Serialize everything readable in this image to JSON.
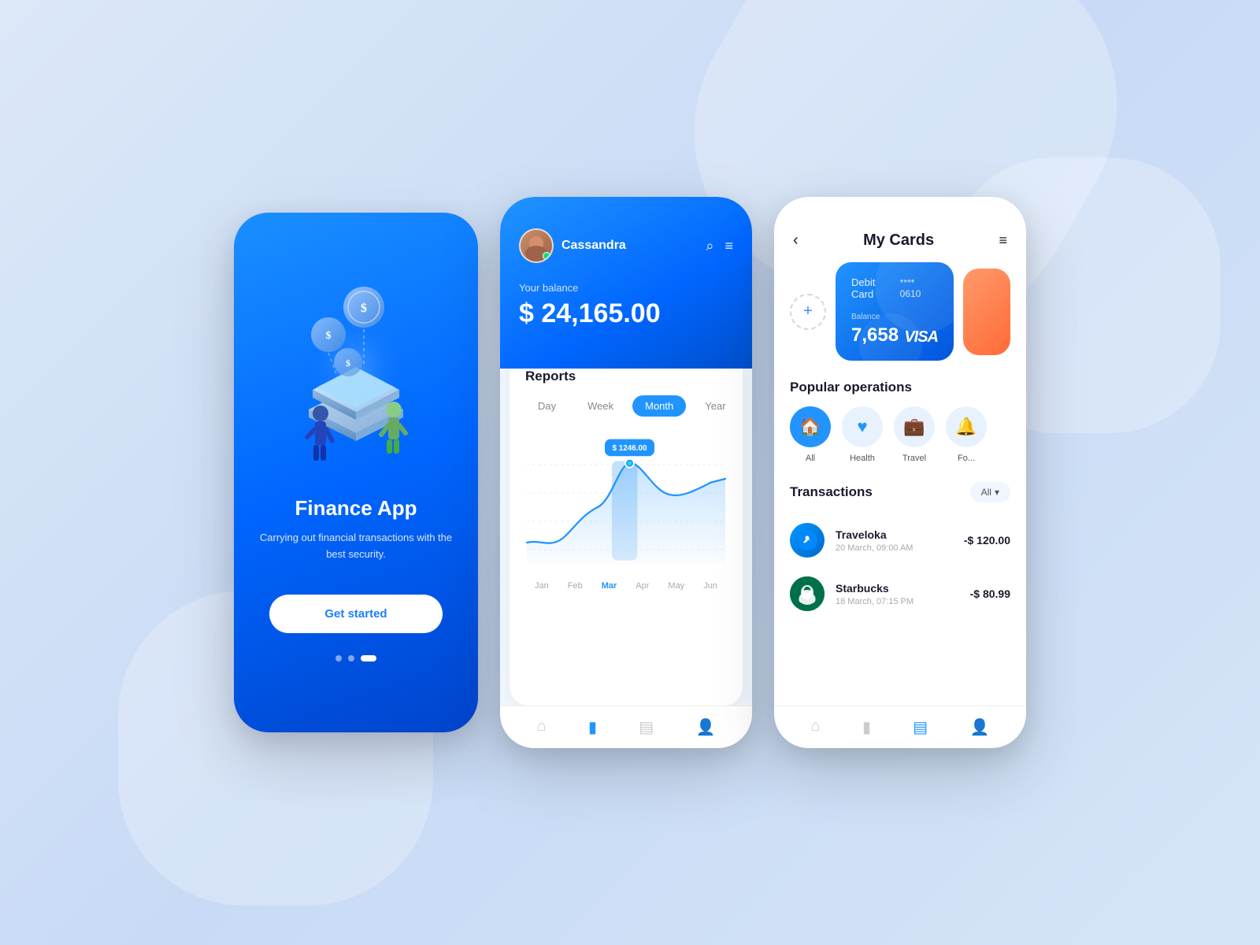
{
  "background": {
    "color1": "#dce8f8",
    "color2": "#c8daf5"
  },
  "phone1": {
    "title": "Finance App",
    "subtitle": "Carrying out financial transactions\nwith the best security.",
    "button_label": "Get started",
    "dots": [
      "inactive",
      "inactive",
      "active"
    ]
  },
  "phone2": {
    "username": "Cassandra",
    "balance_label": "Your balance",
    "balance": "$ 24,165.00",
    "reports_title": "Reports",
    "time_tabs": [
      "Day",
      "Week",
      "Month",
      "Year"
    ],
    "active_tab": "Month",
    "chart_tooltip": "$ 1246.00",
    "chart_x_labels": [
      "Jan",
      "Feb",
      "Mar",
      "Apr",
      "May",
      "Jun"
    ],
    "active_month": "Mar",
    "nav_icons": [
      "home",
      "chart",
      "cards",
      "profile"
    ]
  },
  "phone3": {
    "title": "My Cards",
    "back_label": "<",
    "menu_label": "≡",
    "add_card_label": "+",
    "card": {
      "type": "Debit Card",
      "number": "**** 0610",
      "balance_label": "Balance",
      "balance": "7,658",
      "brand": "VISA"
    },
    "popular_operations_title": "Popular operations",
    "operations": [
      {
        "icon": "🏠",
        "label": "All",
        "active": true
      },
      {
        "icon": "♥",
        "label": "Health",
        "active": false
      },
      {
        "icon": "💼",
        "label": "Travel",
        "active": false
      },
      {
        "icon": "🔔",
        "label": "Fo...",
        "active": false
      }
    ],
    "transactions_title": "Transactions",
    "filter_label": "All",
    "transactions": [
      {
        "name": "Traveloka",
        "date": "20 March, 09:00 AM",
        "amount": "-$ 120.00",
        "icon": "✈"
      },
      {
        "name": "Starbucks",
        "date": "18 March, 07:15 PM",
        "amount": "-$ 80.99",
        "icon": "☕"
      }
    ],
    "nav_icons": [
      "home",
      "chart",
      "cards",
      "profile"
    ]
  }
}
